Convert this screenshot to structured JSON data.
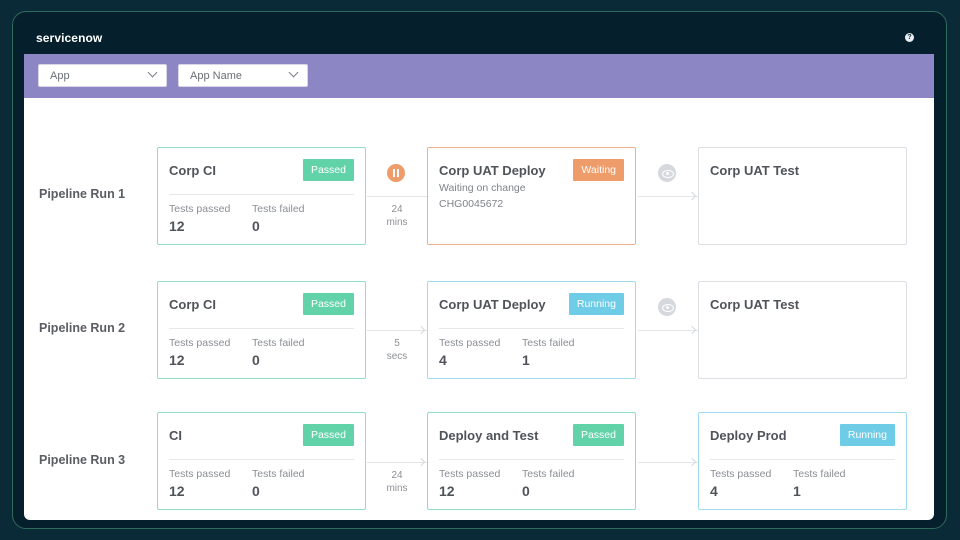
{
  "brand": {
    "logo": "servicenow",
    "help_icon": "question-icon"
  },
  "filters": [
    {
      "label": "App",
      "icon": "chevron-down-icon"
    },
    {
      "label": "App Name",
      "icon": "chevron-down-icon"
    }
  ],
  "colors": {
    "passed": "#62d3a8",
    "waiting": "#ee9c6a",
    "running": "#6fcce6",
    "filterbar": "#8c86c4"
  },
  "pipelines": [
    {
      "label": "Pipeline Run 1",
      "stages": [
        {
          "title": "Corp CI",
          "status": "Passed",
          "tests_passed_label": "Tests passed",
          "tests_passed": "12",
          "tests_failed_label": "Tests failed",
          "tests_failed": "0"
        },
        {
          "title": "Corp UAT Deploy",
          "status": "Waiting",
          "line1": "Waiting on change",
          "line2": "CHG0045672"
        },
        {
          "title": "Corp UAT Test"
        }
      ],
      "gaps": [
        {
          "value": "24",
          "unit": "mins",
          "icon": "pause-icon"
        },
        {
          "icon": "eye-icon"
        }
      ]
    },
    {
      "label": "Pipeline Run 2",
      "stages": [
        {
          "title": "Corp CI",
          "status": "Passed",
          "tests_passed_label": "Tests passed",
          "tests_passed": "12",
          "tests_failed_label": "Tests failed",
          "tests_failed": "0"
        },
        {
          "title": "Corp UAT Deploy",
          "status": "Running",
          "tests_passed_label": "Tests passed",
          "tests_passed": "4",
          "tests_failed_label": "Tests failed",
          "tests_failed": "1"
        },
        {
          "title": "Corp UAT Test"
        }
      ],
      "gaps": [
        {
          "value": "5",
          "unit": "secs"
        },
        {
          "icon": "eye-icon"
        }
      ]
    },
    {
      "label": "Pipeline Run 3",
      "stages": [
        {
          "title": "CI",
          "status": "Passed",
          "tests_passed_label": "Tests passed",
          "tests_passed": "12",
          "tests_failed_label": "Tests failed",
          "tests_failed": "0"
        },
        {
          "title": "Deploy and Test",
          "status": "Passed",
          "tests_passed_label": "Tests passed",
          "tests_passed": "12",
          "tests_failed_label": "Tests failed",
          "tests_failed": "0"
        },
        {
          "title": "Deploy Prod",
          "status": "Running",
          "tests_passed_label": "Tests passed",
          "tests_passed": "4",
          "tests_failed_label": "Tests failed",
          "tests_failed": "1"
        }
      ],
      "gaps": [
        {
          "value": "24",
          "unit": "mins"
        },
        {}
      ]
    }
  ]
}
